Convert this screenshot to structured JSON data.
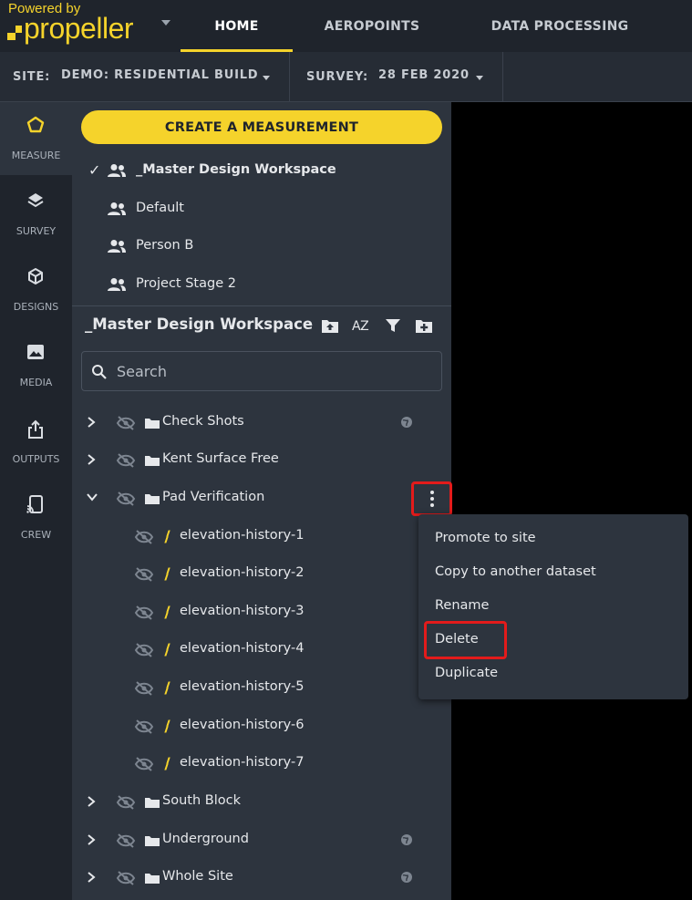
{
  "brand": {
    "powered_by": "Powered by",
    "name": "propeller"
  },
  "nav": {
    "home": "HOME",
    "aeropoints": "AEROPOINTS",
    "data_processing": "DATA PROCESSING"
  },
  "site": {
    "label": "SITE:",
    "value": "DEMO: RESIDENTIAL BUILD"
  },
  "survey": {
    "label": "SURVEY:",
    "value": "28 FEB 2020"
  },
  "rail": [
    {
      "label": "MEASURE",
      "icon": "pentagon-icon"
    },
    {
      "label": "SURVEY",
      "icon": "layers-icon"
    },
    {
      "label": "DESIGNS",
      "icon": "cube-icon"
    },
    {
      "label": "MEDIA",
      "icon": "image-icon"
    },
    {
      "label": "OUTPUTS",
      "icon": "export-icon"
    },
    {
      "label": "CREW",
      "icon": "cast-icon"
    }
  ],
  "create_button": "CREATE A MEASUREMENT",
  "workspaces": [
    "_Master Design Workspace",
    "Default",
    "Person B",
    "Project Stage 2"
  ],
  "workspace_title": "_Master Design Workspace",
  "sort_label": "AZ",
  "search_placeholder": "Search",
  "tree": {
    "folders_top": [
      "Check Shots",
      "Kent Surface Free",
      "Pad Verification"
    ],
    "children": [
      "elevation-history-1",
      "elevation-history-2",
      "elevation-history-3",
      "elevation-history-4",
      "elevation-history-5",
      "elevation-history-6",
      "elevation-history-7"
    ],
    "folders_bottom": [
      "South Block",
      "Underground",
      "Whole Site"
    ]
  },
  "context_menu": [
    "Promote to site",
    "Copy to another dataset",
    "Rename",
    "Delete",
    "Duplicate"
  ],
  "colors": {
    "accent": "#f5d32b",
    "highlight": "#e31b1b",
    "panel": "#2d343e",
    "bar": "#1f242c"
  }
}
